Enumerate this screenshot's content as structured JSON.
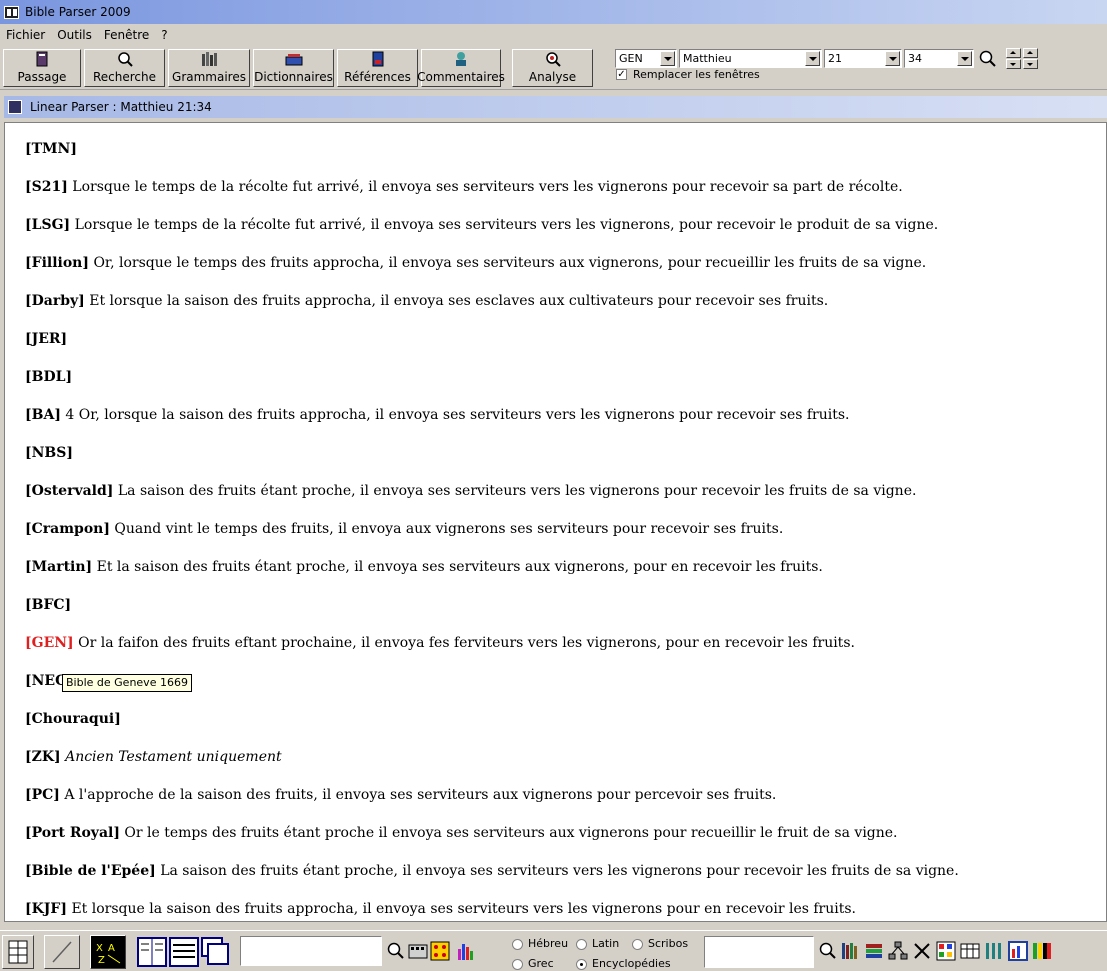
{
  "window": {
    "title": "Bible Parser 2009"
  },
  "menu": {
    "items": [
      "Fichier",
      "Outils",
      "Fenêtre",
      "?"
    ]
  },
  "toolbar": {
    "buttons": [
      "Passage",
      "Recherche",
      "Grammaires",
      "Dictionnaires",
      "Références",
      "Commentaires",
      "Analyse"
    ],
    "version_select": "GEN",
    "book_select": "Matthieu",
    "chapter_select": "21",
    "verse_select": "34",
    "replace_windows_label": "Remplacer les fenêtres",
    "replace_windows_checked": true
  },
  "child_window": {
    "title": "Linear Parser : Matthieu 21:34"
  },
  "verses": [
    {
      "tag": "[TMN]",
      "text": ""
    },
    {
      "tag": "[S21]",
      "text": "Lorsque le temps de la récolte fut arrivé, il envoya ses serviteurs vers les vignerons pour recevoir sa part de récolte."
    },
    {
      "tag": "[LSG]",
      "text": "Lorsque le temps de la récolte fut arrivé, il envoya ses serviteurs vers les vignerons, pour recevoir le produit de sa vigne."
    },
    {
      "tag": "[Fillion]",
      "text": "Or, lorsque le temps des fruits approcha, il envoya ses serviteurs aux vignerons, pour recueillir les fruits de sa vigne."
    },
    {
      "tag": "[Darby]",
      "text": "Et lorsque la saison des fruits approcha, il envoya ses esclaves aux cultivateurs pour recevoir ses fruits."
    },
    {
      "tag": "[JER]",
      "text": ""
    },
    {
      "tag": "[BDL]",
      "text": ""
    },
    {
      "tag": "[BA]",
      "text": "4 Or, lorsque la saison des fruits approcha, il envoya ses serviteurs vers les vignerons pour recevoir ses fruits."
    },
    {
      "tag": "[NBS]",
      "text": ""
    },
    {
      "tag": "[Ostervald]",
      "text": "La saison des fruits étant proche, il envoya ses serviteurs vers les vignerons pour recevoir les fruits de sa vigne."
    },
    {
      "tag": "[Crampon]",
      "text": "Quand vint le temps des fruits, il envoya aux vignerons ses serviteurs pour recevoir ses fruits."
    },
    {
      "tag": "[Martin]",
      "text": "Et la saison des fruits étant proche, il envoya ses serviteurs aux vignerons, pour en recevoir les fruits."
    },
    {
      "tag": "[BFC]",
      "text": ""
    },
    {
      "tag": "[GEN]",
      "text": "Or la faifon des fruits eftant prochaine, il envoya fes ferviteurs vers les vignerons, pour en recevoir les fruits.",
      "active": true
    },
    {
      "tag": "[NEG",
      "text": ""
    },
    {
      "tag": "[Chouraqui]",
      "text": ""
    },
    {
      "tag": "[ZK]",
      "text": "Ancien Testament uniquement",
      "italic": true
    },
    {
      "tag": "[PC]",
      "text": "A l'approche de la saison des fruits, il envoya ses serviteurs aux vignerons pour percevoir ses fruits."
    },
    {
      "tag": "[Port Royal]",
      "text": "Or le temps des fruits étant proche il envoya ses serviteurs aux vignerons pour recueillir le fruit de sa vigne."
    },
    {
      "tag": "[Bible de l'Epée]",
      "text": "La saison des fruits étant proche, il envoya ses serviteurs vers les vignerons pour recevoir les fruits de sa vigne."
    },
    {
      "tag": "[KJF]",
      "text": "Et lorsque la saison des fruits approcha, il envoya ses serviteurs vers les vignerons pour en recevoir les fruits."
    }
  ],
  "tooltip": "Bible de Geneve 1669",
  "colors": {
    "active_tag": "#e02020",
    "title_gradient_start": "#7a96df"
  },
  "bottom": {
    "radios": [
      {
        "label": "Hébreu",
        "checked": false
      },
      {
        "label": "Latin",
        "checked": false
      },
      {
        "label": "Scribos",
        "checked": false
      },
      {
        "label": "Grec",
        "checked": false
      },
      {
        "label": "Encyclopédies",
        "checked": true
      }
    ]
  }
}
